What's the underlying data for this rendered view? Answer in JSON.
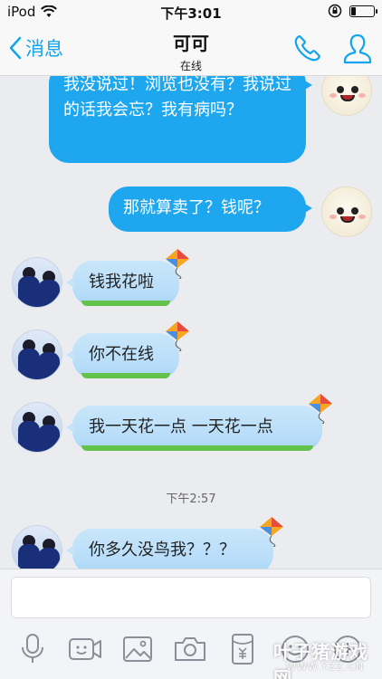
{
  "status_bar": {
    "carrier": "iPod",
    "time": "下午3:01",
    "battery_level": 0.2
  },
  "nav": {
    "back_label": "消息",
    "title": "可可",
    "subtitle": "在线"
  },
  "messages": [
    {
      "sender": "me",
      "text": "我没说过！浏览也没有？我说过的话我会忘？我有病吗？"
    },
    {
      "sender": "me",
      "text": "那就算卖了？钱呢？"
    },
    {
      "sender": "other",
      "text": "钱我花啦"
    },
    {
      "sender": "other",
      "text": "你不在线"
    },
    {
      "sender": "other",
      "text": "我一天花一点 一天花一点"
    },
    {
      "sender": "other",
      "text": "你多久没鸟我？？？"
    }
  ],
  "time_separator": "下午2:57",
  "toolbar": {
    "icons": [
      "microphone-icon",
      "video-icon",
      "image-icon",
      "camera-icon",
      "red-packet-icon",
      "emoji-icon",
      "plus-icon"
    ]
  },
  "watermark": {
    "main": "叶子猪游戏网",
    "sub": "WWW.YZZ.CN"
  },
  "colors": {
    "accent": "#12a4ec",
    "bubble_me": "#1ea7ef",
    "bubble_other": "#c8e6fb",
    "grass": "#62c24a",
    "background": "#ebecf0"
  }
}
